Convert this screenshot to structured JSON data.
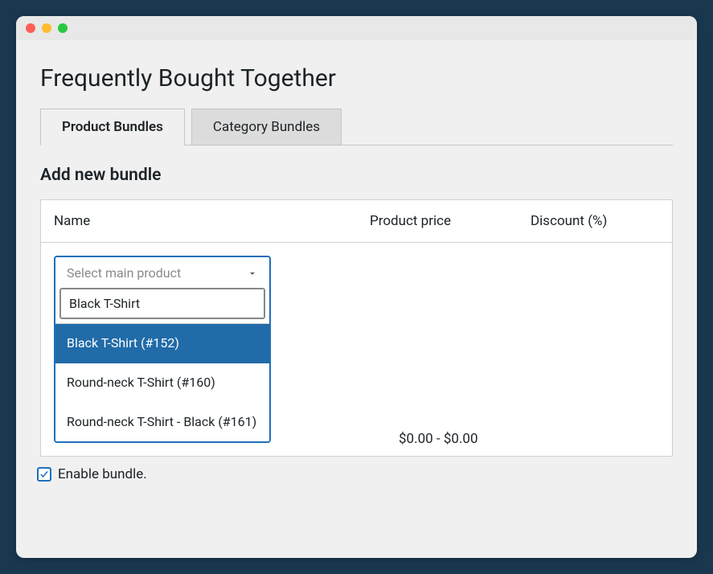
{
  "page": {
    "title": "Frequently Bought Together",
    "section_title": "Add new bundle"
  },
  "tabs": [
    {
      "label": "Product Bundles",
      "active": true
    },
    {
      "label": "Category Bundles",
      "active": false
    }
  ],
  "columns": {
    "name": "Name",
    "price": "Product price",
    "discount": "Discount (%)"
  },
  "select": {
    "placeholder": "Select main product",
    "search_value": "Black T-Shirt",
    "options": [
      {
        "label": "Black T-Shirt (#152)",
        "highlighted": true
      },
      {
        "label": "Round-neck T-Shirt (#160)",
        "highlighted": false
      },
      {
        "label": "Round-neck T-Shirt - Black (#161)",
        "highlighted": false
      }
    ]
  },
  "price_range": "$0.00 - $0.00",
  "enable": {
    "label": "Enable bundle.",
    "checked": true
  }
}
